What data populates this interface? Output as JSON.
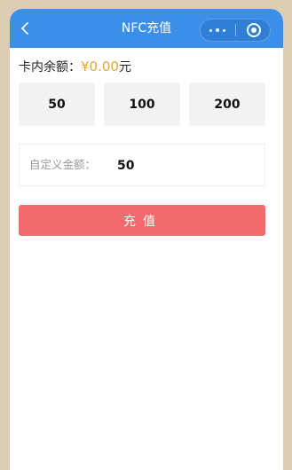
{
  "nav": {
    "back_icon": "chevron-left-icon",
    "title": "NFC充值",
    "capsule": {
      "more_icon": "more-dots-icon",
      "close_icon": "target-close-icon"
    },
    "bar_color": "#3b8fe8"
  },
  "balance": {
    "label": "卡内余额：",
    "amount": "¥0.00",
    "unit": "元",
    "amount_color": "#e3a53c"
  },
  "amount_options": [
    {
      "label": "50"
    },
    {
      "label": "100"
    },
    {
      "label": "200"
    }
  ],
  "custom_amount": {
    "label": "自定义金额：",
    "value": "50"
  },
  "submit": {
    "label": "充值",
    "color": "#f26a6d"
  }
}
